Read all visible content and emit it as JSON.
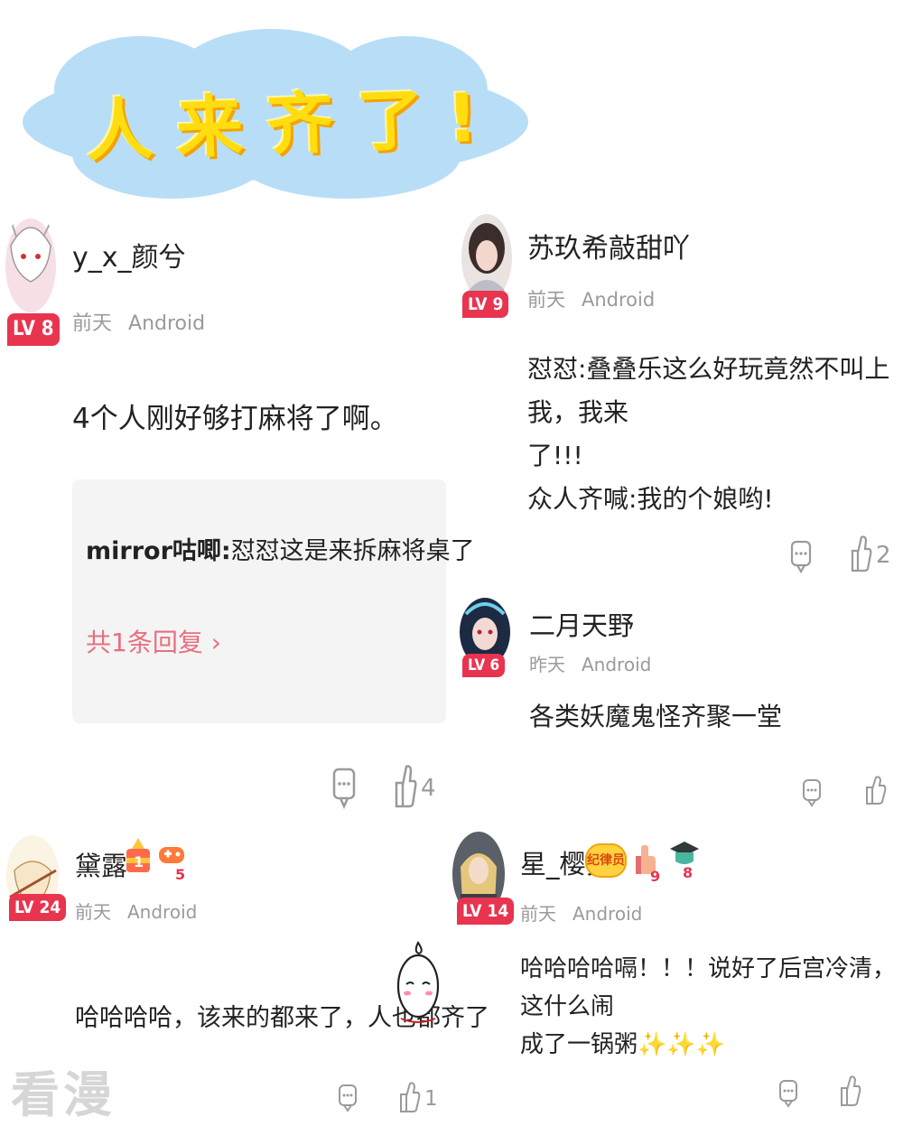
{
  "banner": {
    "title": "人来齐了!"
  },
  "comments": [
    {
      "username": "y_x_颜兮",
      "level": "LV 8",
      "time": "前天",
      "platform": "Android",
      "text": "4个人刚好够打麻将了啊。",
      "reply": {
        "author": "mirror咕唧:",
        "text": "怼怼这是来拆麻将桌了",
        "count_label": "共1条回复 ›"
      },
      "likes": "4"
    },
    {
      "username": "苏玖希敲甜吖",
      "level": "LV 9",
      "time": "前天",
      "platform": "Android",
      "text_lines": [
        "怼怼:叠叠乐这么好玩竟然不叫上我，我来",
        "了!!!",
        "众人齐喊:我的个娘哟!"
      ],
      "likes": "2"
    },
    {
      "username": "二月天野",
      "level": "LV 6",
      "time": "昨天",
      "platform": "Android",
      "text": "各类妖魔鬼怪齐聚一堂",
      "likes": ""
    },
    {
      "username": "黛露",
      "level": "LV 24",
      "time": "前天",
      "platform": "Android",
      "text": "哈哈哈哈，该来的都来了，人也都齐了",
      "badges": [
        "1",
        "5"
      ],
      "likes": "1"
    },
    {
      "username": "星_樱梦",
      "level": "LV 14",
      "time": "前天",
      "platform": "Android",
      "badge_label": "纪律员",
      "badges": [
        "9",
        "8"
      ],
      "text_lines": [
        "哈哈哈哈嗝！！！说好了后宫冷清，这什么闹",
        "成了一锅粥✨✨✨"
      ],
      "likes": ""
    }
  ],
  "watermark": "看漫",
  "colors": {
    "level_badge": "#e8344f",
    "reply_link": "#e86f7f",
    "banner_cloud": "#b8def7",
    "banner_text": "#ffdd10"
  }
}
